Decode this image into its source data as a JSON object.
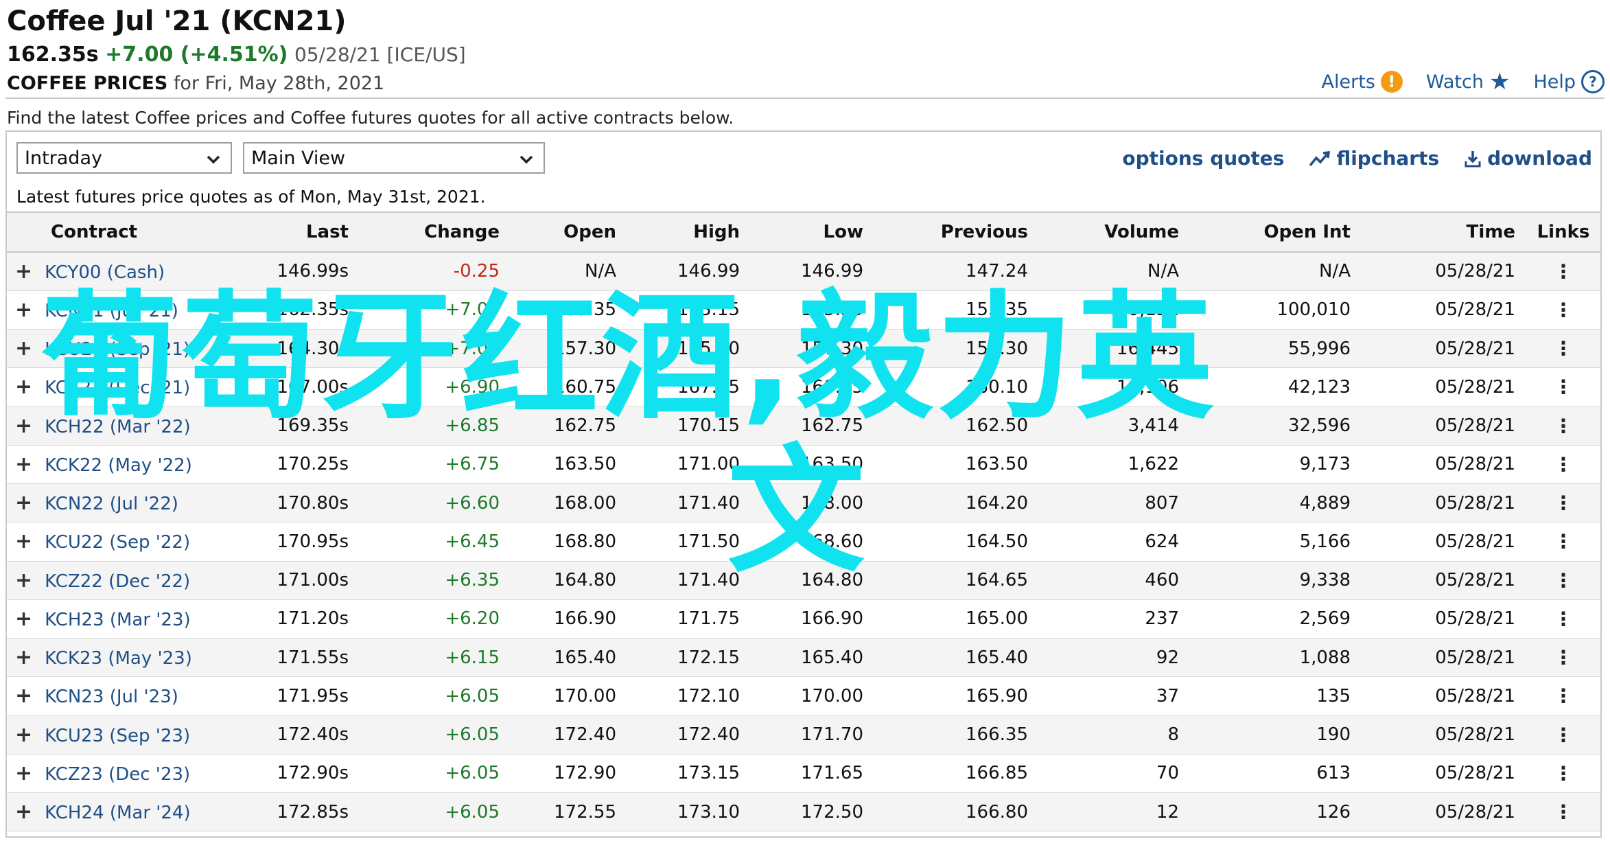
{
  "header": {
    "title": "Coffee Jul '21 (KCN21)",
    "price": "162.35s",
    "change": "+7.00 (+4.51%)",
    "date_exchange": "05/28/21 [ICE/US]",
    "prices_label": "COFFEE PRICES",
    "prices_for": " for Fri, May 28th, 2021"
  },
  "top_links": {
    "alerts": "Alerts",
    "alerts_icon": "alert-icon",
    "watch": "Watch",
    "watch_icon": "star-icon",
    "help": "Help",
    "help_icon": "help-icon"
  },
  "description": "Find the latest Coffee prices and Coffee futures quotes for all active contracts below.",
  "controls": {
    "interval": "Intraday",
    "view": "Main View",
    "options_quotes": "options quotes",
    "flipcharts": "flipcharts",
    "download": "download"
  },
  "as_of": "Latest futures price quotes as of Mon, May 31st, 2021.",
  "table": {
    "headers": [
      "Contract",
      "Last",
      "Change",
      "Open",
      "High",
      "Low",
      "Previous",
      "Volume",
      "Open Int",
      "Time",
      "Links"
    ],
    "rows": [
      [
        "KCY00 (Cash)",
        "146.99s",
        "-0.25",
        "N/A",
        "146.99",
        "146.99",
        "147.24",
        "N/A",
        "N/A",
        "05/28/21"
      ],
      [
        "KCN21 (Jul '21)",
        "162.35s",
        "+7.00",
        "155.35",
        "163.15",
        "155.35",
        "155.35",
        "30,122",
        "100,010",
        "05/28/21"
      ],
      [
        "KCU21 (Sep '21)",
        "164.30s",
        "+7.00",
        "157.30",
        "165.10",
        "157.30",
        "157.30",
        "16,445",
        "55,996",
        "05/28/21"
      ],
      [
        "KCZ21 (Dec '21)",
        "167.00s",
        "+6.90",
        "160.75",
        "167.85",
        "160.75",
        "160.10",
        "10,106",
        "42,123",
        "05/28/21"
      ],
      [
        "KCH22 (Mar '22)",
        "169.35s",
        "+6.85",
        "162.75",
        "170.15",
        "162.75",
        "162.50",
        "3,414",
        "32,596",
        "05/28/21"
      ],
      [
        "KCK22 (May '22)",
        "170.25s",
        "+6.75",
        "163.50",
        "171.00",
        "163.50",
        "163.50",
        "1,622",
        "9,173",
        "05/28/21"
      ],
      [
        "KCN22 (Jul '22)",
        "170.80s",
        "+6.60",
        "168.00",
        "171.40",
        "168.00",
        "164.20",
        "807",
        "4,889",
        "05/28/21"
      ],
      [
        "KCU22 (Sep '22)",
        "170.95s",
        "+6.45",
        "168.80",
        "171.50",
        "168.60",
        "164.50",
        "624",
        "5,166",
        "05/28/21"
      ],
      [
        "KCZ22 (Dec '22)",
        "171.00s",
        "+6.35",
        "164.80",
        "171.40",
        "164.80",
        "164.65",
        "460",
        "9,338",
        "05/28/21"
      ],
      [
        "KCH23 (Mar '23)",
        "171.20s",
        "+6.20",
        "166.90",
        "171.75",
        "166.90",
        "165.00",
        "237",
        "2,569",
        "05/28/21"
      ],
      [
        "KCK23 (May '23)",
        "171.55s",
        "+6.15",
        "165.40",
        "172.15",
        "165.40",
        "165.40",
        "92",
        "1,088",
        "05/28/21"
      ],
      [
        "KCN23 (Jul '23)",
        "171.95s",
        "+6.05",
        "170.00",
        "172.10",
        "170.00",
        "165.90",
        "37",
        "135",
        "05/28/21"
      ],
      [
        "KCU23 (Sep '23)",
        "172.40s",
        "+6.05",
        "172.40",
        "172.40",
        "171.70",
        "166.35",
        "8",
        "190",
        "05/28/21"
      ],
      [
        "KCZ23 (Dec '23)",
        "172.90s",
        "+6.05",
        "172.90",
        "173.15",
        "171.65",
        "166.85",
        "70",
        "613",
        "05/28/21"
      ],
      [
        "KCH24 (Mar '24)",
        "172.85s",
        "+6.05",
        "172.55",
        "173.10",
        "172.50",
        "166.80",
        "12",
        "126",
        "05/28/21"
      ]
    ]
  },
  "overlay": {
    "line1": "葡萄牙红酒,毅力英",
    "line2": "文"
  },
  "colors": {
    "positive": "#1e7a2a",
    "negative": "#c2281d",
    "link": "#1f4f86",
    "overlay": "#10e3ef"
  }
}
